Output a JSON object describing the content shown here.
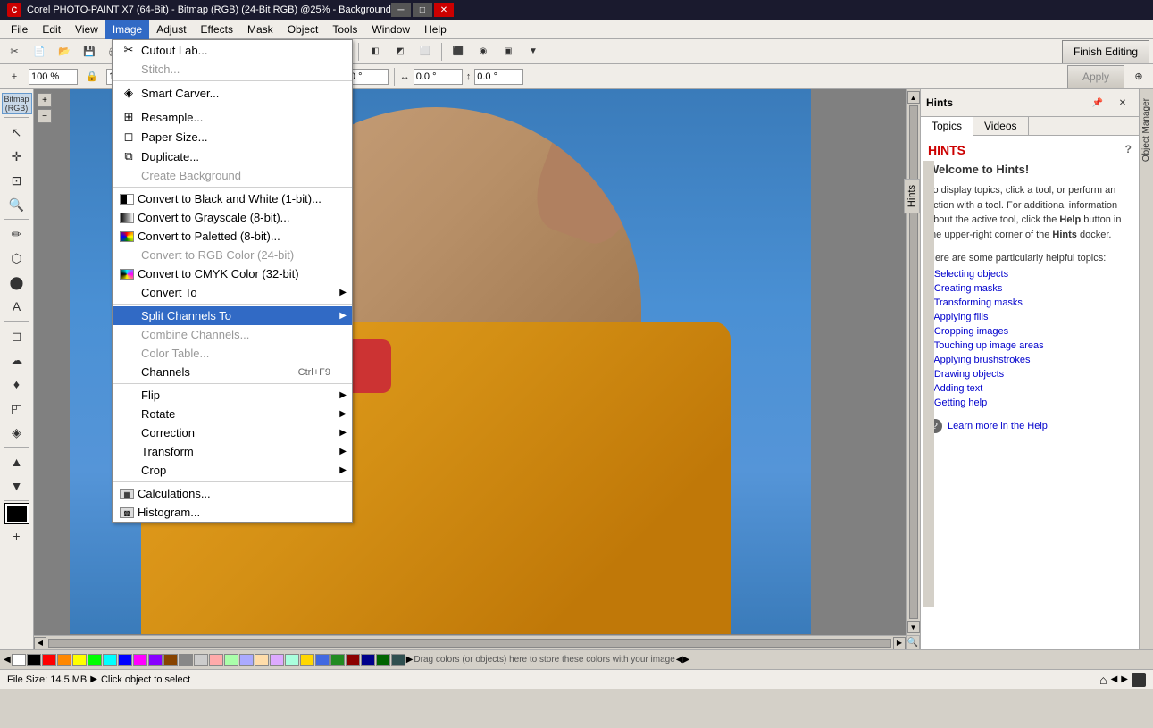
{
  "titlebar": {
    "title": "Corel PHOTO-PAINT X7 (64-Bit) - Bitmap (RGB) (24-Bit RGB) @25% - Background",
    "logo": "C",
    "minimize": "─",
    "maximize": "□",
    "close": "✕"
  },
  "menubar": {
    "items": [
      {
        "label": "File",
        "id": "file"
      },
      {
        "label": "Edit",
        "id": "edit"
      },
      {
        "label": "View",
        "id": "view"
      },
      {
        "label": "Image",
        "id": "image"
      },
      {
        "label": "Adjust",
        "id": "adjust"
      },
      {
        "label": "Effects",
        "id": "effects"
      },
      {
        "label": "Mask",
        "id": "mask"
      },
      {
        "label": "Object",
        "id": "object"
      },
      {
        "label": "Tools",
        "id": "tools"
      },
      {
        "label": "Window",
        "id": "window"
      },
      {
        "label": "Help",
        "id": "help"
      }
    ]
  },
  "toolbar": {
    "finish_editing": "Finish Editing",
    "apply": "Apply",
    "zoom_label": "25%",
    "width_label": "100 %",
    "height_label": "100 %",
    "angle": "0.0 °",
    "x_pos": "0.0 °",
    "y_pos": "0.0 °",
    "x_offset": "0.0 °",
    "y_offset": "0.0 °"
  },
  "left_toolbar": {
    "bitmap_label": "Bitmap (RGB)",
    "tools": [
      {
        "icon": "↖",
        "name": "select"
      },
      {
        "icon": "+",
        "name": "move"
      },
      {
        "icon": "✂",
        "name": "crop"
      },
      {
        "icon": "⊕",
        "name": "zoom"
      },
      {
        "icon": "✏",
        "name": "freehand"
      },
      {
        "icon": "⬡",
        "name": "shape"
      },
      {
        "icon": "⬤",
        "name": "fill"
      },
      {
        "icon": "A",
        "name": "text"
      },
      {
        "icon": "⌀",
        "name": "eraser"
      },
      {
        "icon": "☁",
        "name": "blur"
      },
      {
        "icon": "♦",
        "name": "clone"
      },
      {
        "icon": "◰",
        "name": "red-eye"
      },
      {
        "icon": "◈",
        "name": "dodge"
      },
      {
        "icon": "▲",
        "name": "mesh"
      },
      {
        "icon": "⊞",
        "name": "color-replace"
      },
      {
        "icon": "✦",
        "name": "smart-fill"
      },
      {
        "icon": "▼",
        "name": "eyedropper"
      },
      {
        "icon": "+",
        "name": "add-object"
      }
    ]
  },
  "image_menu": {
    "items": [
      {
        "label": "Cutout Lab...",
        "icon": "✂",
        "id": "cutout-lab",
        "enabled": true
      },
      {
        "label": "Stitch...",
        "icon": "",
        "id": "stitch",
        "enabled": false
      },
      {
        "label": "Smart Carver...",
        "icon": "◈",
        "id": "smart-carver",
        "enabled": true
      },
      {
        "label": "Resample...",
        "icon": "⊞",
        "id": "resample",
        "enabled": true
      },
      {
        "label": "Paper Size...",
        "icon": "◻",
        "id": "paper-size",
        "enabled": true
      },
      {
        "label": "Duplicate...",
        "icon": "⧉",
        "id": "duplicate",
        "enabled": true
      },
      {
        "label": "Create Background",
        "icon": "",
        "id": "create-background",
        "enabled": false
      },
      {
        "label": "Convert to Black and White (1-bit)...",
        "icon": "◑",
        "id": "convert-bw",
        "enabled": true
      },
      {
        "label": "Convert to Grayscale (8-bit)...",
        "icon": "◐",
        "id": "convert-gray",
        "enabled": true
      },
      {
        "label": "Convert to Paletted (8-bit)...",
        "icon": "▦",
        "id": "convert-palette",
        "enabled": true
      },
      {
        "label": "Convert to RGB Color (24-bit)",
        "icon": "",
        "id": "convert-rgb",
        "enabled": false
      },
      {
        "label": "Convert to CMYK Color (32-bit)",
        "icon": "▨",
        "id": "convert-cmyk",
        "enabled": true
      },
      {
        "label": "Convert To",
        "icon": "",
        "id": "convert-to",
        "enabled": true,
        "submenu": true
      },
      {
        "label": "Split Channels To",
        "icon": "",
        "id": "split-channels",
        "enabled": true,
        "submenu": true,
        "highlighted": true
      },
      {
        "label": "Combine Channels...",
        "icon": "",
        "id": "combine-channels",
        "enabled": false
      },
      {
        "label": "Color Table...",
        "icon": "",
        "id": "color-table",
        "enabled": false
      },
      {
        "label": "Channels",
        "icon": "",
        "id": "channels",
        "enabled": true,
        "shortcut": "Ctrl+F9"
      },
      {
        "label": "Flip",
        "icon": "",
        "id": "flip",
        "enabled": true,
        "submenu": true
      },
      {
        "label": "Rotate",
        "icon": "",
        "id": "rotate",
        "enabled": true,
        "submenu": true
      },
      {
        "label": "Correction",
        "icon": "",
        "id": "correction",
        "enabled": true,
        "submenu": true
      },
      {
        "label": "Transform",
        "icon": "",
        "id": "transform",
        "enabled": true,
        "submenu": true
      },
      {
        "label": "Crop",
        "icon": "",
        "id": "crop",
        "enabled": true,
        "submenu": true
      },
      {
        "label": "Calculations...",
        "icon": "▦",
        "id": "calculations",
        "enabled": true
      },
      {
        "label": "Histogram...",
        "icon": "▩",
        "id": "histogram",
        "enabled": true
      }
    ]
  },
  "hints": {
    "title": "Hints",
    "tabs": [
      "Topics",
      "Videos"
    ],
    "active_tab": "Topics",
    "heading": "HINTS",
    "welcome": "Welcome to Hints!",
    "description": "To display topics, click a tool, or perform an action with a tool. For additional information about the active tool, click the Help button in the upper-right corner of the Hints docker.",
    "topics_title": "Here are some particularly helpful topics:",
    "links": [
      "• Selecting objects",
      "• Creating masks",
      "• Transforming masks",
      "• Applying fills",
      "• Cropping images",
      "• Touching up image areas",
      "• Applying brushstrokes",
      "• Drawing objects",
      "• Adding text",
      "• Getting help"
    ],
    "learn_more": "Learn more in the Help"
  },
  "statusbar": {
    "file_size_label": "File Size: 14.5 MB",
    "triangle_icon": "▶",
    "hint_text": "Click object to select",
    "drag_hint": "Drag colors (or objects) here to store these colors with your image"
  },
  "colors": {
    "accent": "#316ac5",
    "menu_bg": "#ffffff",
    "toolbar_bg": "#f0ede8",
    "hint_heading": "#cc0000",
    "link_color": "#0000cc"
  },
  "color_palette": [
    "#000000",
    "#ffffff",
    "#ff0000",
    "#00ff00",
    "#0000ff",
    "#ffff00",
    "#ff00ff",
    "#00ffff",
    "#ff8800",
    "#8800ff",
    "#00ff88",
    "#ff0088",
    "#888888",
    "#444444",
    "#cccccc",
    "#ff4444",
    "#44ff44",
    "#4444ff",
    "#ffaa44",
    "#aa44ff"
  ]
}
